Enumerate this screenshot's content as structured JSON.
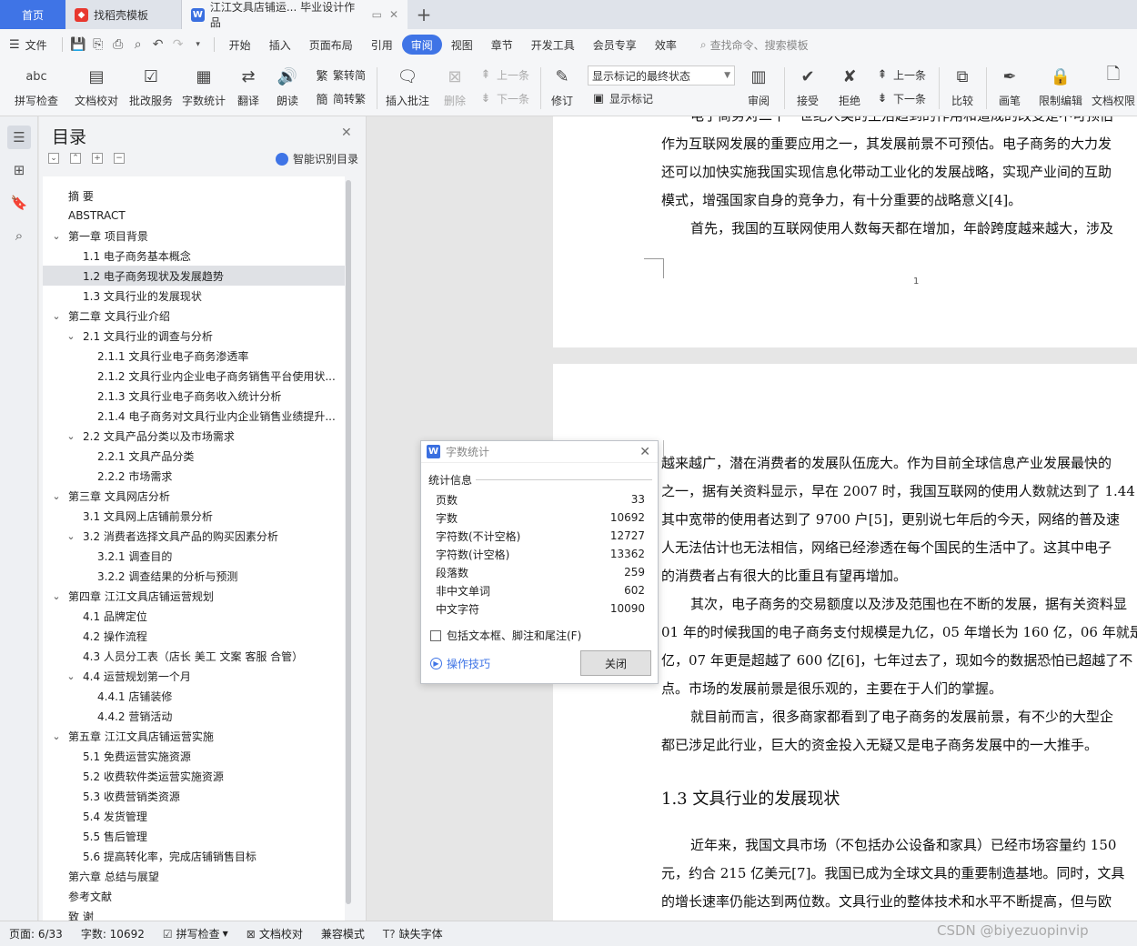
{
  "tabs": [
    {
      "label": "首页"
    },
    {
      "label": "找稻壳模板"
    },
    {
      "label": "江江文具店铺运... 毕业设计作品"
    }
  ],
  "menu": {
    "file": "文件",
    "items": [
      "开始",
      "插入",
      "页面布局",
      "引用",
      "审阅",
      "视图",
      "章节",
      "开发工具",
      "会员专享",
      "效率"
    ],
    "search": "查找命令、搜索模板"
  },
  "ribbon": {
    "spell": "拼写检查",
    "proof": "文档校对",
    "batch": "批改服务",
    "wordcount": "字数统计",
    "translate": "翻译",
    "read": "朗读",
    "to_trad": "繁转简",
    "to_simp": "简转繁",
    "insert_comment": "插入批注",
    "delete": "删除",
    "prev_comment": "上一条",
    "next_comment": "下一条",
    "revise": "修订",
    "markup_state": "显示标记的最终状态",
    "show_markup": "显示标记",
    "review": "审阅",
    "accept": "接受",
    "reject": "拒绝",
    "prev_change": "上一条",
    "next_change": "下一条",
    "compare": "比较",
    "ink": "画笔",
    "restrict": "限制编辑",
    "permission": "文档权限",
    "abc": "abc"
  },
  "toc": {
    "title": "目录",
    "smart": "智能识别目录",
    "items": [
      {
        "label": "摘    要",
        "level": 0,
        "chev": ""
      },
      {
        "label": "ABSTRACT",
        "level": 0,
        "chev": ""
      },
      {
        "label": "第一章  项目背景",
        "level": 0,
        "chev": "v"
      },
      {
        "label": "1.1 电子商务基本概念",
        "level": 1,
        "chev": ""
      },
      {
        "label": "1.2 电子商务现状及发展趋势",
        "level": 1,
        "chev": "",
        "selected": true
      },
      {
        "label": "1.3 文具行业的发展现状",
        "level": 1,
        "chev": ""
      },
      {
        "label": "第二章  文具行业介绍",
        "level": 0,
        "chev": "v"
      },
      {
        "label": "2.1 文具行业的调查与分析",
        "level": 1,
        "chev": "v"
      },
      {
        "label": "2.1.1 文具行业电子商务渗透率",
        "level": 2,
        "chev": ""
      },
      {
        "label": "2.1.2 文具行业内企业电子商务销售平台使用状...",
        "level": 2,
        "chev": ""
      },
      {
        "label": "2.1.3 文具行业电子商务收入统计分析",
        "level": 2,
        "chev": ""
      },
      {
        "label": "2.1.4 电子商务对文具行业内企业销售业绩提升...",
        "level": 2,
        "chev": ""
      },
      {
        "label": "2.2 文具产品分类以及市场需求",
        "level": 1,
        "chev": "v"
      },
      {
        "label": "2.2.1 文具产品分类",
        "level": 2,
        "chev": ""
      },
      {
        "label": "2.2.2 市场需求",
        "level": 2,
        "chev": ""
      },
      {
        "label": "第三章  文具网店分析",
        "level": 0,
        "chev": "v"
      },
      {
        "label": "3.1 文具网上店铺前景分析",
        "level": 1,
        "chev": ""
      },
      {
        "label": "3.2 消费者选择文具产品的购买因素分析",
        "level": 1,
        "chev": "v"
      },
      {
        "label": "3.2.1 调查目的",
        "level": 2,
        "chev": ""
      },
      {
        "label": "3.2.2 调查结果的分析与预测",
        "level": 2,
        "chev": ""
      },
      {
        "label": "第四章  江江文具店铺运营规划",
        "level": 0,
        "chev": "v"
      },
      {
        "label": "4.1 品牌定位",
        "level": 1,
        "chev": ""
      },
      {
        "label": "4.2 操作流程",
        "level": 1,
        "chev": ""
      },
      {
        "label": "4.3 人员分工表（店长  美工  文案  客服  合管）",
        "level": 1,
        "chev": ""
      },
      {
        "label": "4.4 运营规划第一个月",
        "level": 1,
        "chev": "v"
      },
      {
        "label": "4.4.1 店铺装修",
        "level": 2,
        "chev": ""
      },
      {
        "label": "4.4.2 营销活动",
        "level": 2,
        "chev": ""
      },
      {
        "label": "第五章  江江文具店铺运营实施",
        "level": 0,
        "chev": "v"
      },
      {
        "label": "5.1 免费运营实施资源",
        "level": 1,
        "chev": ""
      },
      {
        "label": "5.2 收费软件类运营实施资源",
        "level": 1,
        "chev": ""
      },
      {
        "label": "5.3 收费营销类资源",
        "level": 1,
        "chev": ""
      },
      {
        "label": "5.4 发货管理",
        "level": 1,
        "chev": ""
      },
      {
        "label": "5.5 售后管理",
        "level": 1,
        "chev": ""
      },
      {
        "label": "5.6 提高转化率，完成店铺销售目标",
        "level": 1,
        "chev": ""
      },
      {
        "label": "第六章  总结与展望",
        "level": 0,
        "chev": ""
      },
      {
        "label": "参考文献",
        "level": 0,
        "chev": ""
      },
      {
        "label": "致    谢",
        "level": 0,
        "chev": ""
      }
    ]
  },
  "document": {
    "page1_lines": [
      "电子商务对二十一世纪人类的生活趋到的作用和道成的改变是不可预估",
      "作为互联网发展的重要应用之一，其发展前景不可预估。电子商务的大力发",
      "还可以加快实施我国实现信息化带动工业化的发展战略，实现产业间的互助",
      "模式，增强国家自身的竞争力，有十分重要的战略意义[4]。",
      "首先，我国的互联网使用人数每天都在增加，年龄跨度越来越大，涉及"
    ],
    "page_number": "1",
    "page2_lines_a": [
      "越来越广，潜在消费者的发展队伍庞大。作为目前全球信息产业发展最快的",
      "之一，据有关资料显示，早在 2007 时，我国互联网的使用人数就达到了 1.44",
      "其中宽带的使用者达到了 9700 户[5]，更别说七年后的今天，网络的普及速",
      "人无法估计也无法相信，网络已经渗透在每个国民的生活中了。这其中电子",
      "的消费者占有很大的比重且有望再增加。",
      "其次，电子商务的交易额度以及涉及范围也在不断的发展，据有关资料显",
      "01 年的时候我国的电子商务支付规模是九亿，05 年增长为 160 亿，06 年就是",
      "亿，07 年更是超越了 600 亿[6]，七年过去了，现如今的数据恐怕已超越了不",
      "点。市场的发展前景是很乐观的，主要在于人们的掌握。",
      "就目前而言，很多商家都看到了电子商务的发展前景，有不少的大型企",
      "都已涉足此行业，巨大的资金投入无疑又是电子商务发展中的一大推手。"
    ],
    "heading": "1.3 文具行业的发展现状",
    "page2_lines_b": [
      "近年来，我国文具市场（不包括办公设备和家具）已经市场容量约 150",
      "元，约合 215 亿美元[7]。我国已成为全球文具的重要制造基地。同时，文具",
      "的增长速率仍能达到两位数。文具行业的整体技术和水平不断提高，但与欧"
    ]
  },
  "dialog": {
    "title": "字数统计",
    "section": "统计信息",
    "rows": [
      {
        "label": "页数",
        "value": "33"
      },
      {
        "label": "字数",
        "value": "10692"
      },
      {
        "label": "字符数(不计空格)",
        "value": "12727"
      },
      {
        "label": "字符数(计空格)",
        "value": "13362"
      },
      {
        "label": "段落数",
        "value": "259"
      },
      {
        "label": "非中文单词",
        "value": "602"
      },
      {
        "label": "中文字符",
        "value": "10090"
      }
    ],
    "include": "包括文本框、脚注和尾注(F)",
    "tips": "操作技巧",
    "close": "关闭"
  },
  "status": {
    "page": "页面: 6/33",
    "words": "字数: 10692",
    "spell": "拼写检查",
    "proof": "文档校对",
    "compat": "兼容模式",
    "missing_font": "缺失字体"
  },
  "watermark": "CSDN @biyezuopinvip"
}
